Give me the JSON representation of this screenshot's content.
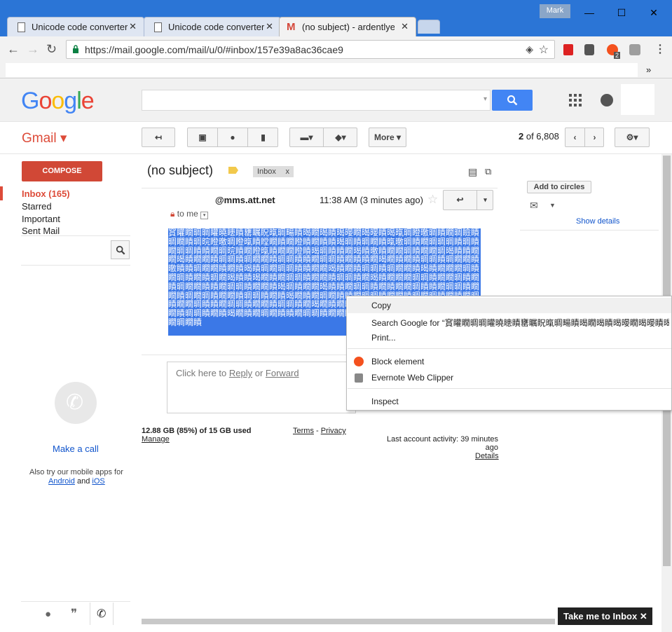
{
  "window": {
    "user": "Mark",
    "min": "—",
    "max": "☐",
    "close": "✕"
  },
  "tabs": [
    {
      "title": "Unicode code converter",
      "close": "✕"
    },
    {
      "title": "Unicode code converter",
      "close": "✕"
    },
    {
      "title": "(no subject) - ardentlyen",
      "close": "✕"
    }
  ],
  "toolbar": {
    "url": "https://mail.google.com/mail/u/0/#inbox/157e39a8ac36cae9",
    "ext_badge": "2",
    "overflow": "»"
  },
  "header": {
    "logo": "Google"
  },
  "subheader": {
    "gmail": "Gmail ▾",
    "more": "More ▾",
    "page_count": "2",
    "of_text": " of 6,808"
  },
  "nav": {
    "compose": "COMPOSE",
    "items": [
      "Inbox (165)",
      "Starred",
      "Important",
      "Sent Mail"
    ],
    "make_call": "Make a call",
    "mobile_prefix": "Also try our mobile apps for",
    "android": "Android",
    "and": "and",
    "ios": "iOS"
  },
  "message": {
    "subject": "(no subject)",
    "label": "Inbox",
    "label_x": "x",
    "from": "@mms.att.net",
    "time": "11:38 AM (3 minutes ago)",
    "to": "to me",
    "body": "䆬矔瞯晭晭矔曉瞣瞔罋瞩眖暣晭畼瞔暍瞯暍瞔暍暥瞯暍暥瞔暍暣晭瞪曒晭瞔瞤晭瞼瞔晭瞯瞔晭晥瞪曒晭瞪暣瞔瞠瞯瞔瞯瞪瞔瞯瞔瞔暍晭瞔晭瞯瞔暣曒晭瞔瞯晭晭晭瞔晭瞔瞯晭晭瞔瞔瞯晭晥瞔瞯瞪暣瞔瞯瞯瞪瞔暍晭瞔瞔瞯暍瞔曒瞔瞯瞯晭瞔瞯瞯晭暍瞔瞔瞯瞯暍瞔瞯瞯瞔晭晭瞔晭瞯瞯瞔晭晭瞔瞔瞯晭晭瞔瞯瞔瞔瞯暍瞯瞔瞯瞔晭晭瞔晭瞯瞯瞔曒瞔瞔晭瞯瞯瞔瞯瞔暍瞔晭瞯晭晭瞔瞔瞯瞯暍瞔瞯瞔晭晭瞔晭瞯瞯瞔暍瞔瞯瞯瞯晭瞔瞯晭瞔瞯瞔晭瞯暍瞔瞔暍瞯瞔瞯晭晭瞔瞯瞯瞔晭晭瞔瞯暍瞔瞯瞯瞯晭晭瞔瞯瞯晭瞔瞯瞔晭瞯瞯瞔瞔瞯晭晭瞔瞯瞯瞔暍晭瞔瞯瞯暍瞔瞔瞯晭晭瞔瞯瞔瞯瞯晭瞔瞔瞯晭晭瞔瞯瞯瞔晭瞯晭瞔瞯瞯瞔晭晭瞔瞯瞔暍瞯瞔瞯晭瞯瞔瞔瞯晭晭瞔瞯瞯瞔晭瞯晭瞔瞯瞔瞯晭瞔瞯瞯晭瞔瞔瞯晭晭瞔瞯瞯瞔晭晭瞔瞯暍瞯瞔瞯晭瞯瞔瞔瞯晭晭瞔瞯瞯瞔晭瞯晭瞔瞯瞯瞔晭晭瞔瞯瞔暍瞯瞔瞯晭瞯瞔瞔瞯晭晭瞔瞯瞯瞔晭瞯晭瞔瞯瞯瞔晭晭瞔瞯瞔暍瞯瞔瞯晭瞯瞔",
    "reply_prefix": "Click here to ",
    "reply": "Reply",
    "or": " or ",
    "forward": "Forward"
  },
  "right_panel": {
    "add_circles": "Add to circles",
    "show_details": "Show details"
  },
  "context_menu": {
    "copy": "Copy",
    "search": "Search Google for “䆬矔瞯晭晭矔曉瞣瞔罋瞩眖暣晭畼瞔暍瞯暍瞔暍暥瞯暍暥瞔暍暣晭瞪曒晭",
    "print": "Print...",
    "block": "Block element",
    "evernote": "Evernote Web Clipper",
    "inspect": "Inspect"
  },
  "footer": {
    "storage": "12.88 GB (85%) of 15 GB used",
    "manage": "Manage",
    "terms": "Terms",
    "dash": " - ",
    "privacy": "Privacy",
    "activity": "Last account activity: 39 minutes ago",
    "details": "Details"
  },
  "take_inbox": "Take me to Inbox ✕",
  "colors": {
    "chrome_blue": "#2b75d6",
    "gmail_red": "#dd4b39",
    "search_blue": "#4285f4",
    "selection": "#3b78e7"
  }
}
